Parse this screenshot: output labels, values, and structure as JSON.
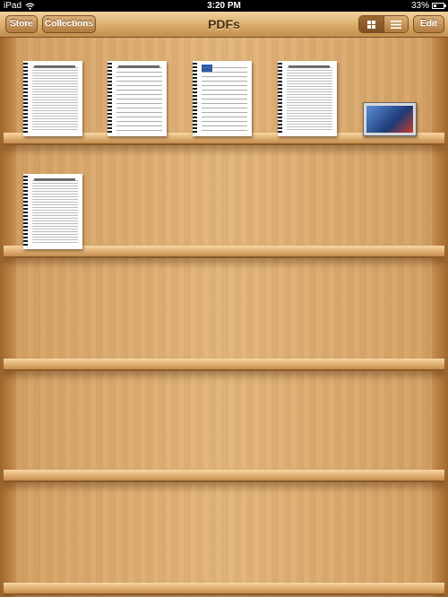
{
  "status_bar": {
    "device": "iPad",
    "time": "3:20 PM",
    "battery_text": "33%",
    "battery_level": 0.33
  },
  "toolbar": {
    "store_label": "Store",
    "collections_label": "Collections",
    "title": "PDFs",
    "edit_label": "Edit",
    "view_mode": "grid"
  },
  "colors": {
    "toolbar": "#d7a865",
    "wood": "#e2b57c",
    "title_text": "#4a2e12"
  },
  "shelves": [
    {
      "items": [
        {
          "type": "spiral-document"
        },
        {
          "type": "spiral-form"
        },
        {
          "type": "spiral-form-logo"
        },
        {
          "type": "spiral-document"
        },
        {
          "type": "video-thumbnail"
        }
      ]
    },
    {
      "items": [
        {
          "type": "spiral-document"
        }
      ]
    },
    {
      "items": []
    },
    {
      "items": []
    },
    {
      "items": []
    }
  ]
}
